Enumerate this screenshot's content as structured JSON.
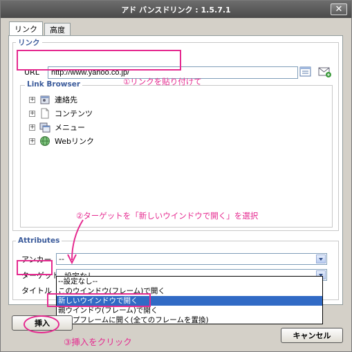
{
  "window": {
    "title": "アド バンスドリンク : 1.5.7.1",
    "close_glyph": "✕"
  },
  "tabs": [
    {
      "label": "リンク",
      "active": true
    },
    {
      "label": "高度",
      "active": false
    }
  ],
  "link_section": {
    "legend": "リンク",
    "url_label": "URL",
    "url_value": "http://www.yahoo.co.jp/",
    "browse_icon": "file-browser-icon",
    "email_icon": "email-link-icon"
  },
  "link_browser": {
    "title": "Link Browser",
    "items": [
      {
        "label": "連絡先",
        "icon": "contacts-icon"
      },
      {
        "label": "コンテンツ",
        "icon": "page-icon"
      },
      {
        "label": "メニュー",
        "icon": "menu-icon"
      },
      {
        "label": "Webリンク",
        "icon": "globe-icon"
      }
    ]
  },
  "attributes": {
    "legend": "Attributes",
    "anchor_label": "アンカー",
    "anchor_value": "--",
    "target_label": "ターゲット",
    "target_value": "--設定なし--",
    "title_label": "タイトル",
    "target_options": [
      "--設定なし--",
      "このウインドウ(フレーム)で開く",
      "新しいウインドウで開く",
      "親ウインドウ(フレーム)で開く",
      "トップフレームに開く(全てのフレームを置換)"
    ],
    "selected_option_index": 2
  },
  "buttons": {
    "insert": "挿入",
    "cancel": "キャンセル"
  },
  "annotations": {
    "step1": "①リンクを貼り付けて",
    "step2": "②ターゲットを「新しいウインドウで開く」を選択",
    "step3": "③挿入をクリック"
  },
  "colors": {
    "annotation": "#e5298f",
    "selection": "#316ac5",
    "legend": "#3a5a9a"
  }
}
